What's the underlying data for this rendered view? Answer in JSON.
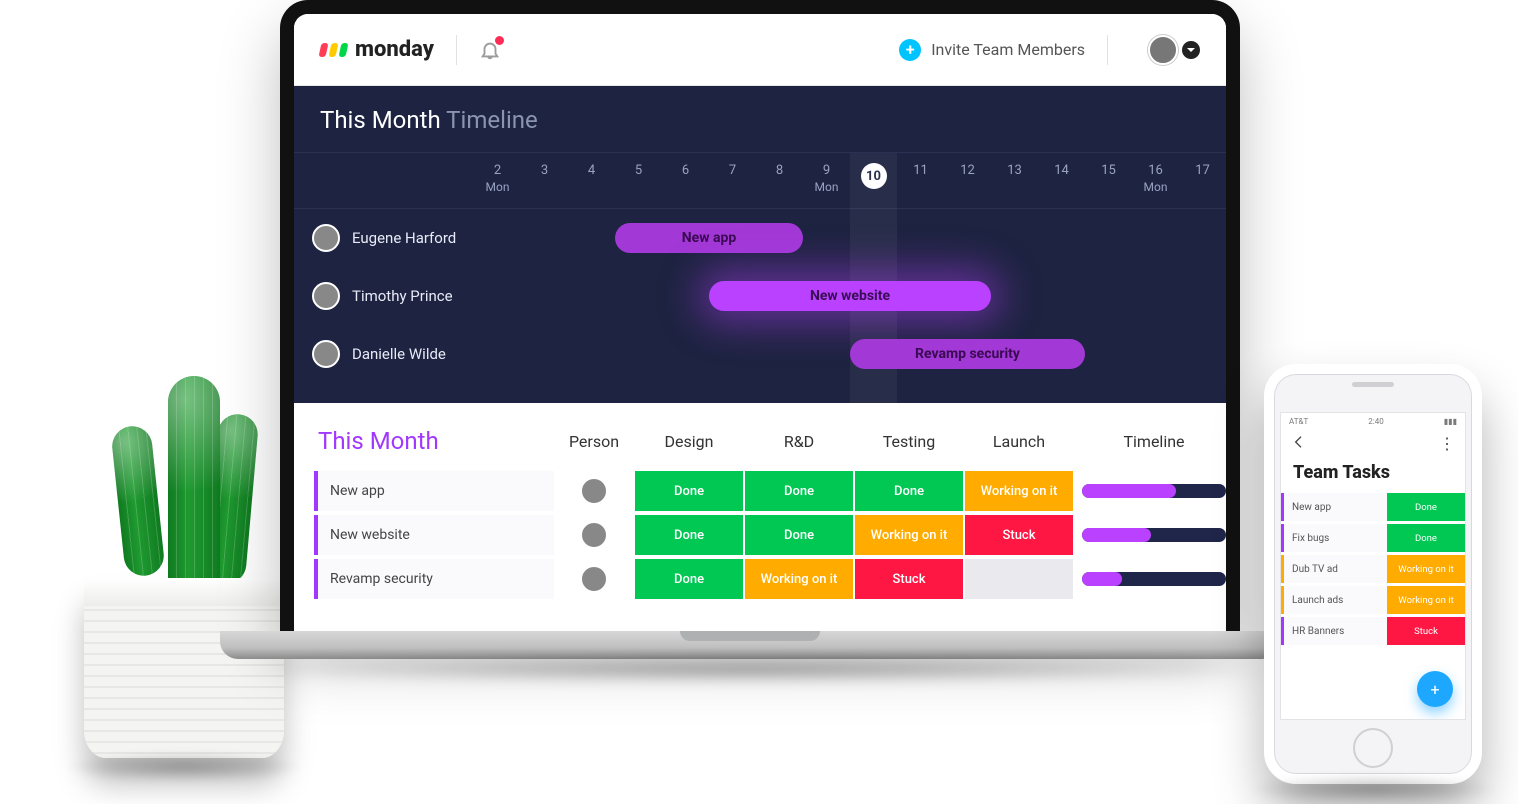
{
  "header": {
    "brand": "monday",
    "invite_label": "Invite Team Members"
  },
  "timeline": {
    "title_main": "This Month",
    "title_sub": "Timeline",
    "days": [
      {
        "n": "2",
        "dow": "Mon"
      },
      {
        "n": "3"
      },
      {
        "n": "4"
      },
      {
        "n": "5"
      },
      {
        "n": "6"
      },
      {
        "n": "7"
      },
      {
        "n": "8"
      },
      {
        "n": "9",
        "dow": "Mon"
      },
      {
        "n": "10",
        "today": true
      },
      {
        "n": "11"
      },
      {
        "n": "12"
      },
      {
        "n": "13"
      },
      {
        "n": "14"
      },
      {
        "n": "15"
      },
      {
        "n": "16",
        "dow": "Mon"
      },
      {
        "n": "17"
      }
    ],
    "rows": [
      {
        "person": "Eugene Harford",
        "bar": {
          "label": "New app",
          "start": 5,
          "end": 8,
          "style": "purple"
        }
      },
      {
        "person": "Timothy Prince",
        "bar": {
          "label": "New website",
          "start": 7,
          "end": 12,
          "style": "bright"
        }
      },
      {
        "person": "Danielle Wilde",
        "bar": {
          "label": "Revamp security",
          "start": 10,
          "end": 14,
          "style": "purple"
        }
      }
    ]
  },
  "table": {
    "title": "This Month",
    "columns": [
      "Person",
      "Design",
      "R&D",
      "Testing",
      "Launch",
      "Timeline"
    ],
    "rows": [
      {
        "name": "New app",
        "cells": [
          "Done",
          "Done",
          "Done",
          "Working on it"
        ],
        "timeline_pct": 65
      },
      {
        "name": "New website",
        "cells": [
          "Done",
          "Done",
          "Working on it",
          "Stuck"
        ],
        "timeline_pct": 48
      },
      {
        "name": "Revamp security",
        "cells": [
          "Done",
          "Working on it",
          "Stuck",
          ""
        ],
        "timeline_pct": 28
      }
    ]
  },
  "phone": {
    "status_carrier": "AT&T",
    "status_time": "2:40",
    "title": "Team Tasks",
    "rows": [
      {
        "name": "New app",
        "status": "Done",
        "cls": "s-done",
        "accent": "purple"
      },
      {
        "name": "Fix bugs",
        "status": "Done",
        "cls": "s-done",
        "accent": "purple"
      },
      {
        "name": "Dub TV ad",
        "status": "Working on it",
        "cls": "s-work",
        "accent": "orange"
      },
      {
        "name": "Launch ads",
        "status": "Working on it",
        "cls": "s-work",
        "accent": "orange"
      },
      {
        "name": "HR Banners",
        "status": "Stuck",
        "cls": "s-stuck",
        "accent": "purple"
      }
    ]
  },
  "status_labels": {
    "Done": "s-done",
    "Working on it": "s-work",
    "Stuck": "s-stuck",
    "": "s-empty"
  }
}
